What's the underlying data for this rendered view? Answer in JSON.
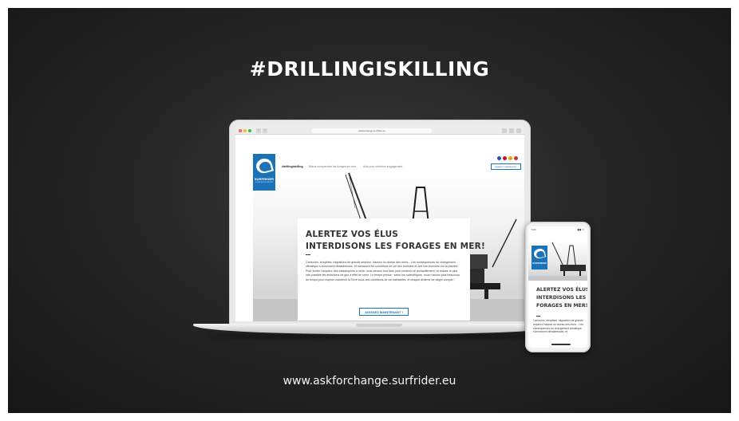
{
  "hashtag": "#DRILLINGISKILLING",
  "footer_url": "www.askforchange.surfrider.eu",
  "laptop": {
    "url": "askforchange.surfrider.eu",
    "brand": "SURFRIDER",
    "brand_sub": "FOUNDATION EUROPE",
    "nav": {
      "active": "#drillingiskilling",
      "link1": "Mieux comprendre les forages en mer",
      "link2": "Avis pour info/mon engagement",
      "cta": "Agissez maintenant !"
    },
    "card": {
      "title_line1": "ALERTEZ VOS ÉLUS",
      "title_line2": "INTERDISONS LES FORAGES EN MER!",
      "body": "Canicules, tempêtes, migrations de grande ampleur, hausse du niveau des mers... Les conséquences du changement climatique s'annoncent désastreuses, et menacent les conditions de vie des humains et des non-humains sur la planète. Pour limiter l'ampleur des catastrophes à venir, nous devons tout faire pour contenir ce réchauffement, et réduire le plus vite possible les émissions de gaz à effet de serre. Le temps presse : selon les scientifiques, nous n'avons plus beaucoup de temps pour espérer maintenir la Terre sous des conditions de vie habitables, et chaque dixième de degré compte !",
      "button": "AGISSEZ MAINTENANT !"
    }
  },
  "phone": {
    "time": "9:41",
    "signal": "▮▮▮ ▭",
    "brand": "SURFRIDER",
    "title_line1": "ALERTEZ VOS ÉLUS",
    "title_line2": "INTERDISONS LES",
    "title_line3": "FORAGES EN MER!",
    "body": "Canicules, tempêtes, migrations de grande ampleur, hausse du niveau des mers... Les conséquences du changement climatique s'annoncent désastreuses, et"
  }
}
